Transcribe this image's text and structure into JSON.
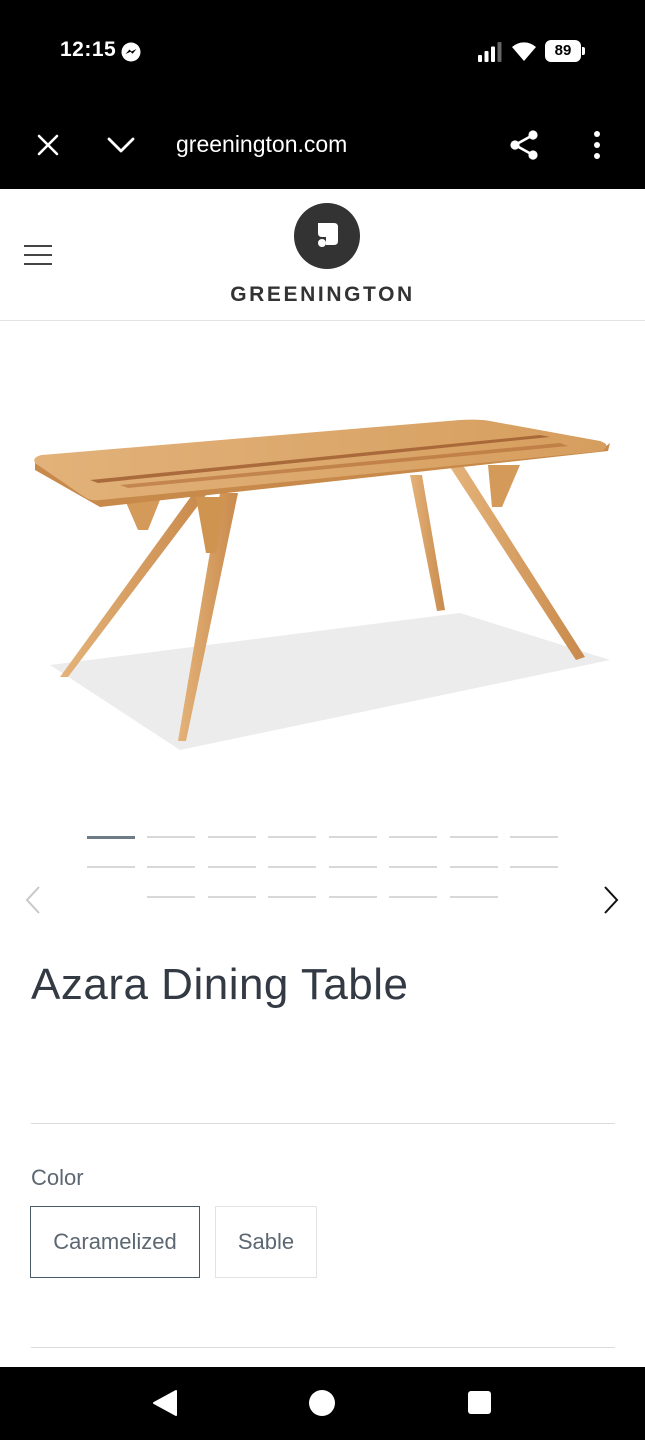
{
  "status_bar": {
    "time": "12:15",
    "battery": "89",
    "icons": [
      "messenger-icon",
      "signal-icon",
      "wifi-icon",
      "battery-icon"
    ]
  },
  "browser": {
    "url": "greenington.com",
    "icons": [
      "close-icon",
      "chevron-down-icon",
      "share-icon",
      "more-icon"
    ]
  },
  "site_header": {
    "brand": "GREENINGTON",
    "icons": [
      "hamburger-icon",
      "logo-icon"
    ]
  },
  "gallery": {
    "image_alt_name": "table-product-image",
    "active_index": 0,
    "icons": [
      "chevron-left-icon",
      "chevron-right-icon"
    ]
  },
  "product": {
    "title": "Azara Dining Table",
    "color_label": "Color",
    "color_options": [
      {
        "label": "Caramelized",
        "selected": true
      },
      {
        "label": "Sable",
        "selected": false
      }
    ]
  },
  "nav_bar": {
    "icons": [
      "back-icon",
      "home-icon",
      "recents-icon"
    ]
  },
  "colors": {
    "bar_black": "#000000",
    "text_dark": "#333a44",
    "text_muted": "#5c6772",
    "wood": "#d9a564"
  }
}
